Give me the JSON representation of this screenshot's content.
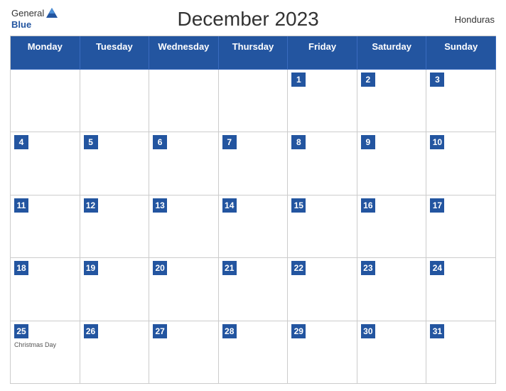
{
  "header": {
    "logo": {
      "general": "General",
      "blue": "Blue"
    },
    "title": "December 2023",
    "country": "Honduras"
  },
  "days_of_week": [
    "Monday",
    "Tuesday",
    "Wednesday",
    "Thursday",
    "Friday",
    "Saturday",
    "Sunday"
  ],
  "weeks": [
    [
      {
        "num": null,
        "holiday": null
      },
      {
        "num": null,
        "holiday": null
      },
      {
        "num": null,
        "holiday": null
      },
      {
        "num": null,
        "holiday": null
      },
      {
        "num": "1",
        "holiday": null
      },
      {
        "num": "2",
        "holiday": null
      },
      {
        "num": "3",
        "holiday": null
      }
    ],
    [
      {
        "num": "4",
        "holiday": null
      },
      {
        "num": "5",
        "holiday": null
      },
      {
        "num": "6",
        "holiday": null
      },
      {
        "num": "7",
        "holiday": null
      },
      {
        "num": "8",
        "holiday": null
      },
      {
        "num": "9",
        "holiday": null
      },
      {
        "num": "10",
        "holiday": null
      }
    ],
    [
      {
        "num": "11",
        "holiday": null
      },
      {
        "num": "12",
        "holiday": null
      },
      {
        "num": "13",
        "holiday": null
      },
      {
        "num": "14",
        "holiday": null
      },
      {
        "num": "15",
        "holiday": null
      },
      {
        "num": "16",
        "holiday": null
      },
      {
        "num": "17",
        "holiday": null
      }
    ],
    [
      {
        "num": "18",
        "holiday": null
      },
      {
        "num": "19",
        "holiday": null
      },
      {
        "num": "20",
        "holiday": null
      },
      {
        "num": "21",
        "holiday": null
      },
      {
        "num": "22",
        "holiday": null
      },
      {
        "num": "23",
        "holiday": null
      },
      {
        "num": "24",
        "holiday": null
      }
    ],
    [
      {
        "num": "25",
        "holiday": "Christmas Day"
      },
      {
        "num": "26",
        "holiday": null
      },
      {
        "num": "27",
        "holiday": null
      },
      {
        "num": "28",
        "holiday": null
      },
      {
        "num": "29",
        "holiday": null
      },
      {
        "num": "30",
        "holiday": null
      },
      {
        "num": "31",
        "holiday": null
      }
    ]
  ],
  "colors": {
    "header_bg": "#2355a0",
    "header_text": "#ffffff",
    "border": "#cccccc"
  }
}
